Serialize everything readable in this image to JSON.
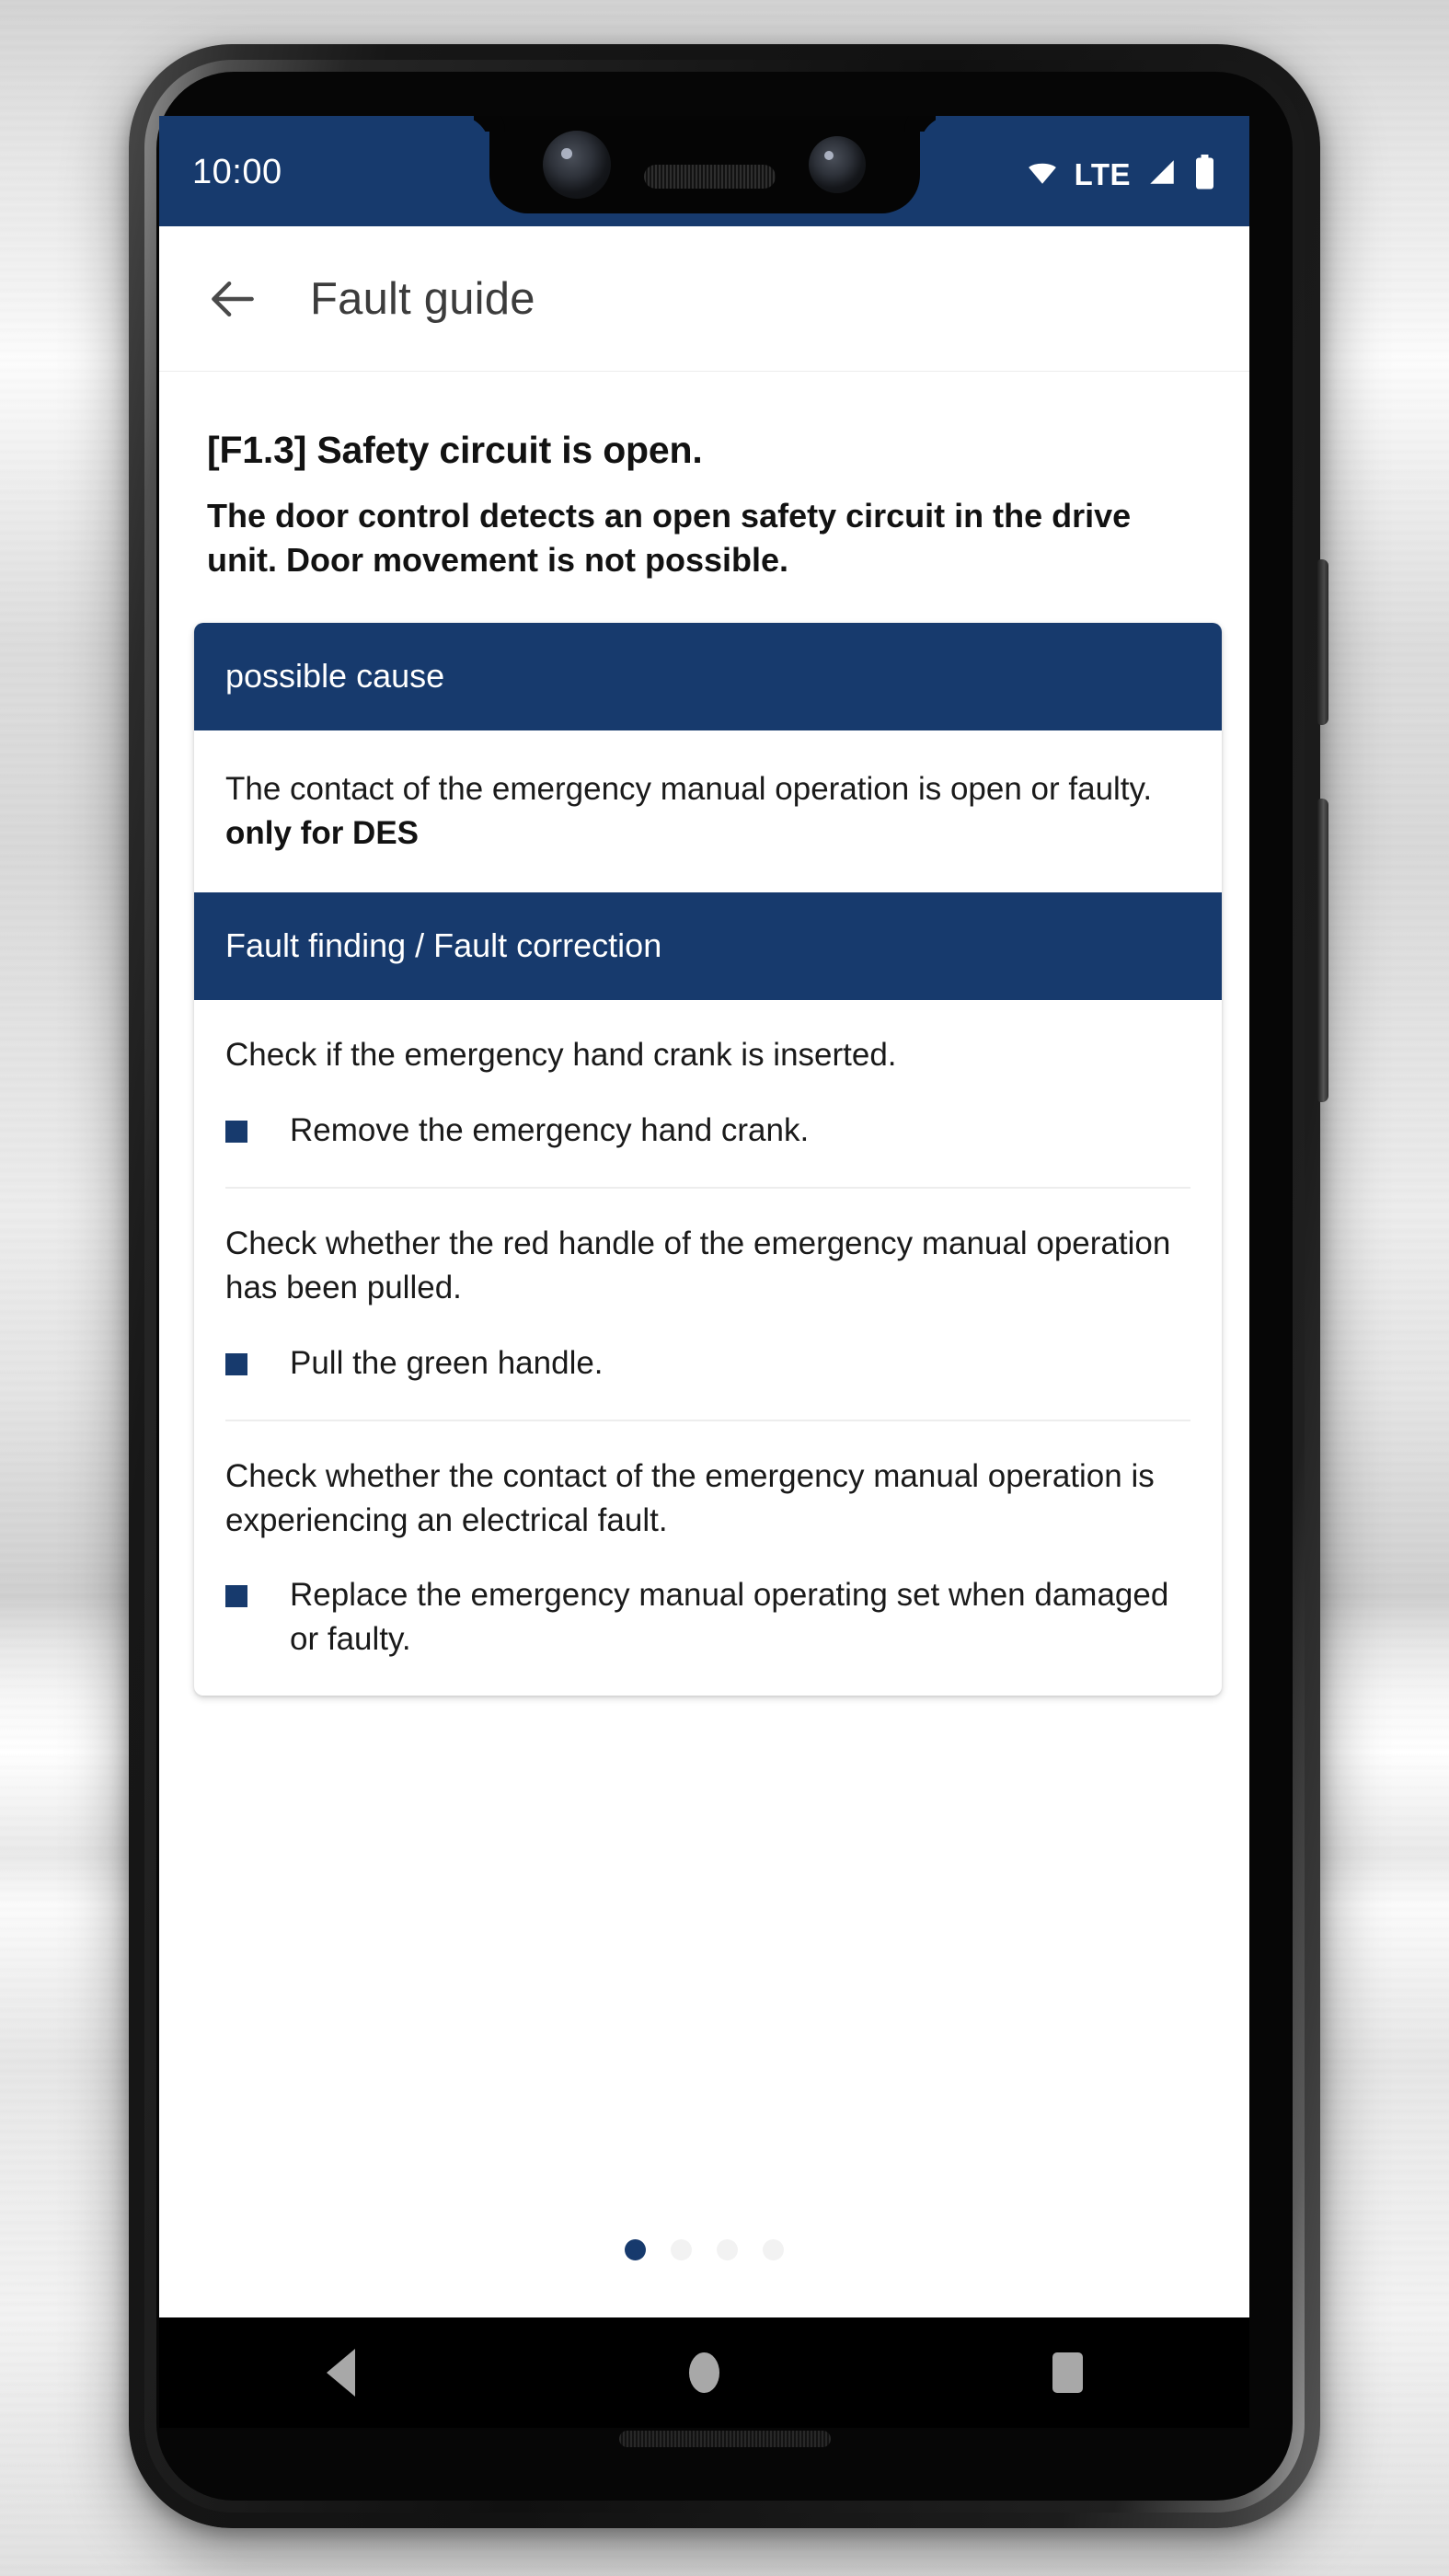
{
  "status_bar": {
    "time": "10:00",
    "network_label": "LTE",
    "icons": [
      "wifi-icon",
      "signal-icon",
      "battery-icon"
    ],
    "background_color": "#173a6d"
  },
  "app_bar": {
    "back_label": "back-arrow",
    "title": "Fault guide"
  },
  "content": {
    "fault_code_title": "[F1.3] Safety circuit is open.",
    "fault_description": "The door control detects an open safety circuit in the drive unit. Door movement is not possible.",
    "possible_cause": {
      "header": "possible cause",
      "text": "The contact of the emergency manual operation is open or faulty.",
      "note": "only for DES"
    },
    "fault_finding": {
      "header": "Fault finding / Fault correction",
      "steps": [
        {
          "check": "Check if the emergency hand crank is inserted.",
          "action": "Remove the emergency hand crank."
        },
        {
          "check": "Check whether the red handle of the emergency manual operation has been pulled.",
          "action": "Pull the green handle."
        },
        {
          "check": "Check whether the contact of the emergency manual operation is experiencing an electrical fault.",
          "action": "Replace the emergency manual operating set when damaged or faulty."
        }
      ]
    }
  },
  "pagination": {
    "total": 4,
    "active_index": 0
  },
  "nav_bar": {
    "back": "nav-back-icon",
    "home": "nav-home-icon",
    "recents": "nav-recents-icon"
  },
  "theme": {
    "primary_blue": "#173a6d",
    "page_background": "#ffffff",
    "bullet_color": "#173a6d"
  }
}
